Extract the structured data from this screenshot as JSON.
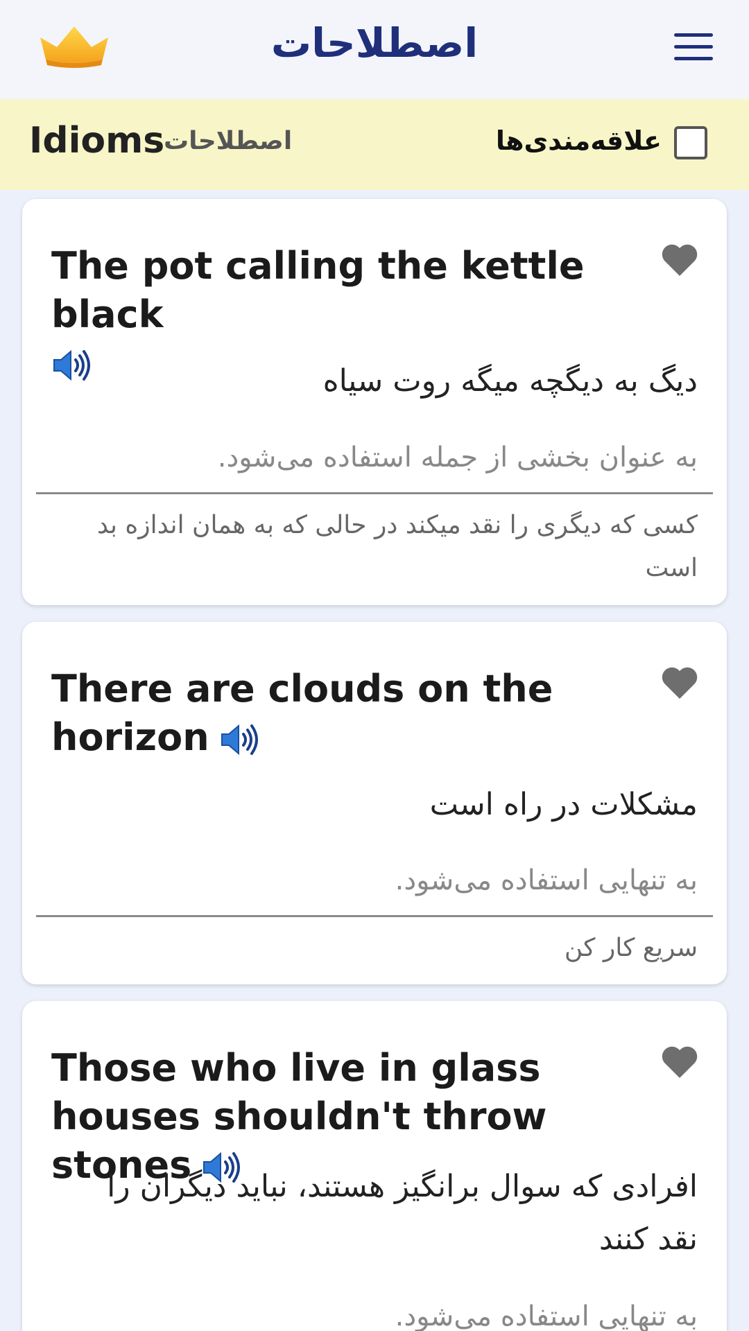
{
  "header": {
    "title": "اصطلاحات"
  },
  "filter": {
    "title_en": "Idioms",
    "title_fa": "اصطلاحات",
    "favorites_label": "علاقه‌مندی‌ها",
    "favorites_checked": false
  },
  "idioms": [
    {
      "phrase": "The pot calling the kettle black",
      "meaning": "دیگ به دیگچه میگه روت سیاه",
      "usage": "به عنوان بخشی از جمله استفاده می‌شود.",
      "example": "کسی که دیگری را نقد میکند در حالی که به همان اندازه بد است"
    },
    {
      "phrase": "There are clouds on the horizon",
      "meaning": "مشکلات در راه است",
      "usage": "به تنهایی استفاده می‌شود.",
      "example": "سریع کار کن"
    },
    {
      "phrase": "Those who live in glass houses shouldn't throw stones",
      "meaning": "افرادی که سوال برانگیز هستند، نباید دیگران را نقد کنند",
      "usage": "به تنهایی استفاده می‌شود."
    }
  ],
  "icons": {
    "crown": "crown-icon",
    "menu": "hamburger-menu-icon",
    "heart": "heart-icon",
    "speaker": "speaker-icon"
  },
  "colors": {
    "title": "#1f2f7a",
    "filter_bg": "#f8f6c8",
    "heart": "#6e6e6e"
  }
}
